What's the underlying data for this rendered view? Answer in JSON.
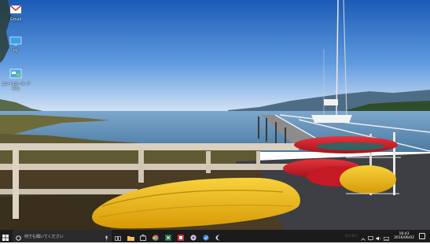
{
  "desktop_icons": [
    {
      "label": "Gmail",
      "icon": "gmail-icon"
    },
    {
      "label": "PC",
      "icon": "computer-icon"
    },
    {
      "label": "コントロール パネル",
      "icon": "control-panel-icon"
    }
  ],
  "taskbar": {
    "search_placeholder": "何でも聞いてください",
    "pinned": [
      {
        "name": "task-view-icon",
        "color": "#ffffff"
      },
      {
        "name": "file-explorer-icon",
        "color": "#f2c14e"
      },
      {
        "name": "store-icon",
        "color": "#ffffff"
      },
      {
        "name": "chrome-icon",
        "color": "#e9462f"
      },
      {
        "name": "excel-icon",
        "color": "#1e7145"
      },
      {
        "name": "media-app-icon",
        "color": "#d13438"
      },
      {
        "name": "app-icon-1",
        "color": "#d0d0d0"
      },
      {
        "name": "app-icon-2",
        "color": "#3a8ee6"
      },
      {
        "name": "app-icon-3",
        "color": "#c8d9ec"
      }
    ]
  },
  "tray": {
    "time": "16:43",
    "date": "2016/06/02",
    "watermark": "SUIBU"
  },
  "colors": {
    "sky_top": "#1d5fb8",
    "sky_bottom": "#cfe0f2",
    "taskbar": "#1b1b1d",
    "kayak_yellow": "#f2b90d",
    "kayak_red": "#d21f2b"
  }
}
